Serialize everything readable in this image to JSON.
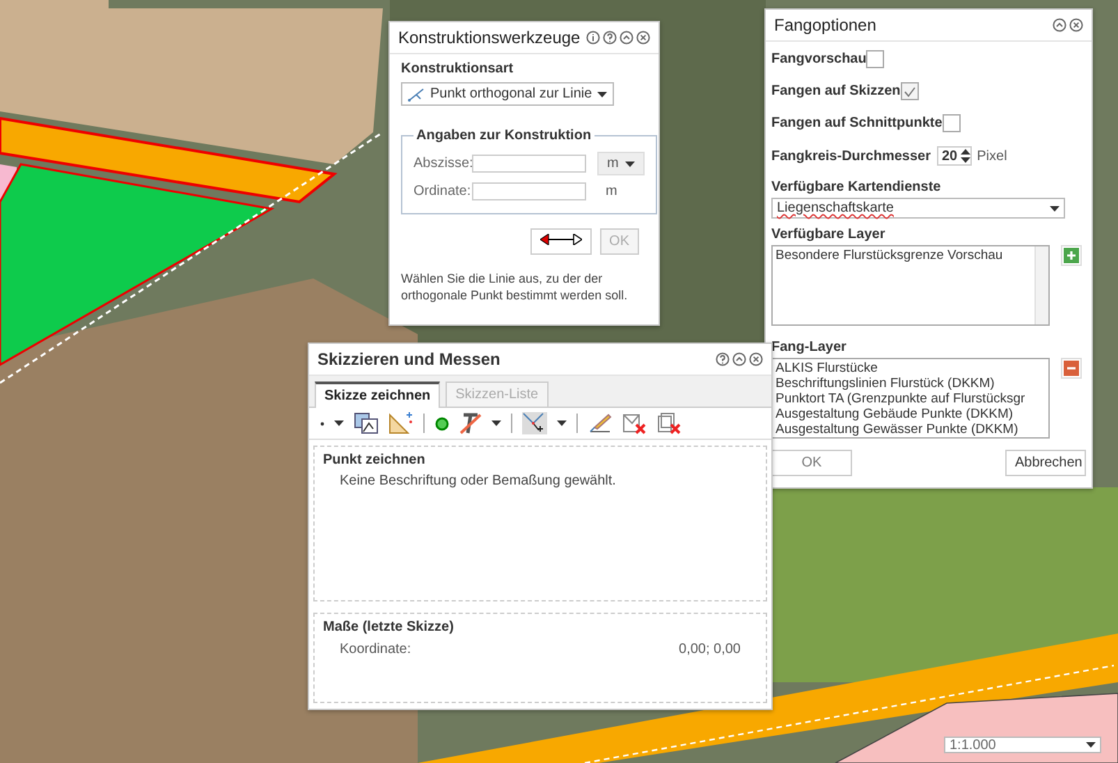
{
  "construction_tools": {
    "title": "Konstruktionswerkzeuge",
    "type_label": "Konstruktionsart",
    "type_value": "Punkt orthogonal zur Linie",
    "group_title": "Angaben zur Konstruktion",
    "fields": [
      {
        "label": "Abszisse:",
        "unit": "m",
        "kind": "dropdown"
      },
      {
        "label": "Ordinate:",
        "unit": "m",
        "kind": "text"
      }
    ],
    "ok_button": {
      "label": "OK",
      "disabled": true
    },
    "hint": "Wählen Sie die Linie aus, zu der der orthogonale Punkt bestimmt werden soll."
  },
  "snap_options": {
    "title": "Fangoptionen",
    "checks": [
      {
        "label": "Fangvorschau",
        "checked": false
      },
      {
        "label": "Fangen auf Skizzen",
        "checked": true
      },
      {
        "label": "Fangen auf Schnittpunkte",
        "checked": false
      }
    ],
    "radius_label": "Fangkreis-Durchmesser",
    "radius_value": "20",
    "radius_unit": "Pixel",
    "services_label": "Verfügbare Kartendienste",
    "service": "Liegenschaftskarte",
    "available_layers_label": "Verfügbare Layer",
    "available_layers": [
      "Besondere Flurstücksgrenze Vorschau"
    ],
    "snap_layers_label": "Fang-Layer",
    "snap_layers": [
      "ALKIS Flurstücke",
      "Beschriftungslinien Flurstück (DKKM)",
      "Punktort TA (Grenzpunkte auf Flurstücksgr",
      "Ausgestaltung Gebäude Punkte (DKKM)",
      "Ausgestaltung Gewässer Punkte (DKKM)"
    ],
    "buttons": [
      "OK",
      "Abbrechen"
    ]
  },
  "sketch": {
    "title": "Skizzieren und Messen",
    "tabs": [
      {
        "label": "Skizze zeichnen",
        "selected": true
      },
      {
        "label": "Skizzen-Liste",
        "selected": false
      }
    ],
    "section_title": "Punkt zeichnen",
    "message": "Keine Beschriftung oder Bemaßung gewählt.",
    "measures_title": "Maße (letzte Skizze)",
    "measures": [
      {
        "label": "Koordinate:",
        "value": "0,00; 0,00"
      }
    ]
  },
  "scale": "1:1.000"
}
